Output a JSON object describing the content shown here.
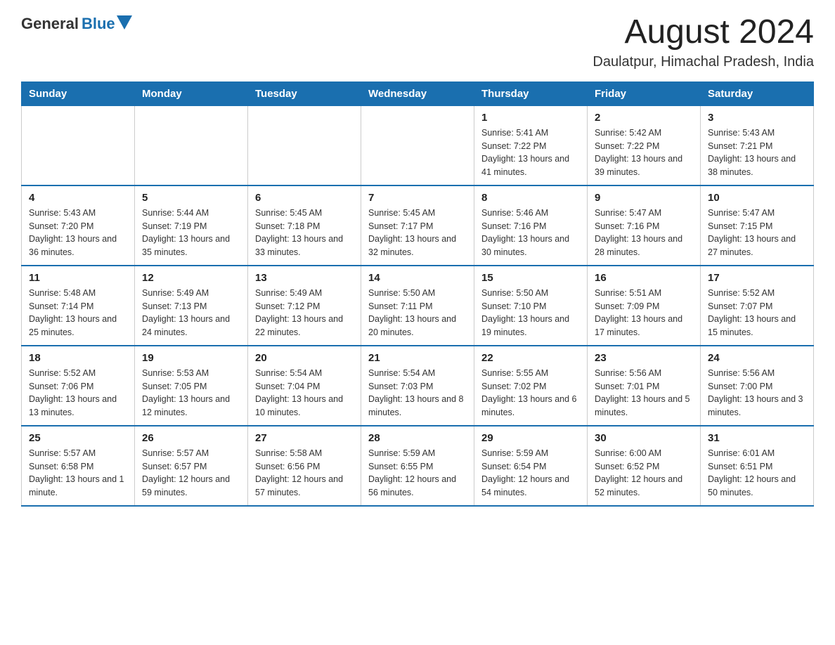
{
  "header": {
    "logo_general": "General",
    "logo_blue": "Blue",
    "month_year": "August 2024",
    "location": "Daulatpur, Himachal Pradesh, India"
  },
  "days_of_week": [
    "Sunday",
    "Monday",
    "Tuesday",
    "Wednesday",
    "Thursday",
    "Friday",
    "Saturday"
  ],
  "weeks": [
    [
      {
        "day": "",
        "info": ""
      },
      {
        "day": "",
        "info": ""
      },
      {
        "day": "",
        "info": ""
      },
      {
        "day": "",
        "info": ""
      },
      {
        "day": "1",
        "info": "Sunrise: 5:41 AM\nSunset: 7:22 PM\nDaylight: 13 hours and 41 minutes."
      },
      {
        "day": "2",
        "info": "Sunrise: 5:42 AM\nSunset: 7:22 PM\nDaylight: 13 hours and 39 minutes."
      },
      {
        "day": "3",
        "info": "Sunrise: 5:43 AM\nSunset: 7:21 PM\nDaylight: 13 hours and 38 minutes."
      }
    ],
    [
      {
        "day": "4",
        "info": "Sunrise: 5:43 AM\nSunset: 7:20 PM\nDaylight: 13 hours and 36 minutes."
      },
      {
        "day": "5",
        "info": "Sunrise: 5:44 AM\nSunset: 7:19 PM\nDaylight: 13 hours and 35 minutes."
      },
      {
        "day": "6",
        "info": "Sunrise: 5:45 AM\nSunset: 7:18 PM\nDaylight: 13 hours and 33 minutes."
      },
      {
        "day": "7",
        "info": "Sunrise: 5:45 AM\nSunset: 7:17 PM\nDaylight: 13 hours and 32 minutes."
      },
      {
        "day": "8",
        "info": "Sunrise: 5:46 AM\nSunset: 7:16 PM\nDaylight: 13 hours and 30 minutes."
      },
      {
        "day": "9",
        "info": "Sunrise: 5:47 AM\nSunset: 7:16 PM\nDaylight: 13 hours and 28 minutes."
      },
      {
        "day": "10",
        "info": "Sunrise: 5:47 AM\nSunset: 7:15 PM\nDaylight: 13 hours and 27 minutes."
      }
    ],
    [
      {
        "day": "11",
        "info": "Sunrise: 5:48 AM\nSunset: 7:14 PM\nDaylight: 13 hours and 25 minutes."
      },
      {
        "day": "12",
        "info": "Sunrise: 5:49 AM\nSunset: 7:13 PM\nDaylight: 13 hours and 24 minutes."
      },
      {
        "day": "13",
        "info": "Sunrise: 5:49 AM\nSunset: 7:12 PM\nDaylight: 13 hours and 22 minutes."
      },
      {
        "day": "14",
        "info": "Sunrise: 5:50 AM\nSunset: 7:11 PM\nDaylight: 13 hours and 20 minutes."
      },
      {
        "day": "15",
        "info": "Sunrise: 5:50 AM\nSunset: 7:10 PM\nDaylight: 13 hours and 19 minutes."
      },
      {
        "day": "16",
        "info": "Sunrise: 5:51 AM\nSunset: 7:09 PM\nDaylight: 13 hours and 17 minutes."
      },
      {
        "day": "17",
        "info": "Sunrise: 5:52 AM\nSunset: 7:07 PM\nDaylight: 13 hours and 15 minutes."
      }
    ],
    [
      {
        "day": "18",
        "info": "Sunrise: 5:52 AM\nSunset: 7:06 PM\nDaylight: 13 hours and 13 minutes."
      },
      {
        "day": "19",
        "info": "Sunrise: 5:53 AM\nSunset: 7:05 PM\nDaylight: 13 hours and 12 minutes."
      },
      {
        "day": "20",
        "info": "Sunrise: 5:54 AM\nSunset: 7:04 PM\nDaylight: 13 hours and 10 minutes."
      },
      {
        "day": "21",
        "info": "Sunrise: 5:54 AM\nSunset: 7:03 PM\nDaylight: 13 hours and 8 minutes."
      },
      {
        "day": "22",
        "info": "Sunrise: 5:55 AM\nSunset: 7:02 PM\nDaylight: 13 hours and 6 minutes."
      },
      {
        "day": "23",
        "info": "Sunrise: 5:56 AM\nSunset: 7:01 PM\nDaylight: 13 hours and 5 minutes."
      },
      {
        "day": "24",
        "info": "Sunrise: 5:56 AM\nSunset: 7:00 PM\nDaylight: 13 hours and 3 minutes."
      }
    ],
    [
      {
        "day": "25",
        "info": "Sunrise: 5:57 AM\nSunset: 6:58 PM\nDaylight: 13 hours and 1 minute."
      },
      {
        "day": "26",
        "info": "Sunrise: 5:57 AM\nSunset: 6:57 PM\nDaylight: 12 hours and 59 minutes."
      },
      {
        "day": "27",
        "info": "Sunrise: 5:58 AM\nSunset: 6:56 PM\nDaylight: 12 hours and 57 minutes."
      },
      {
        "day": "28",
        "info": "Sunrise: 5:59 AM\nSunset: 6:55 PM\nDaylight: 12 hours and 56 minutes."
      },
      {
        "day": "29",
        "info": "Sunrise: 5:59 AM\nSunset: 6:54 PM\nDaylight: 12 hours and 54 minutes."
      },
      {
        "day": "30",
        "info": "Sunrise: 6:00 AM\nSunset: 6:52 PM\nDaylight: 12 hours and 52 minutes."
      },
      {
        "day": "31",
        "info": "Sunrise: 6:01 AM\nSunset: 6:51 PM\nDaylight: 12 hours and 50 minutes."
      }
    ]
  ]
}
